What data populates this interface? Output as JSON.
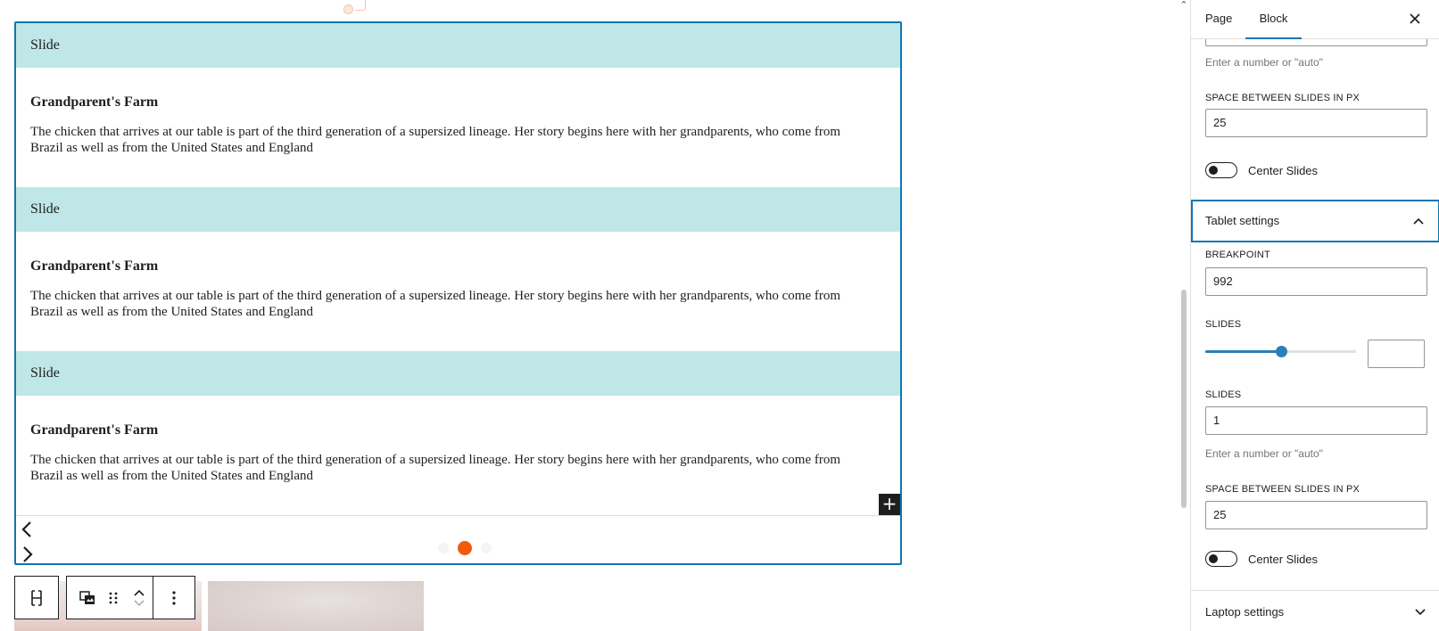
{
  "slider": {
    "slides": [
      {
        "label": "Slide",
        "heading": "Grandparent's Farm",
        "text": "The chicken that arrives at our table is part of the third generation of a supersized lineage. Her story begins here with her grandparents, who come from Brazil as well as from the United States and England"
      },
      {
        "label": "Slide",
        "heading": "Grandparent's Farm",
        "text": "The chicken that arrives at our table is part of the third generation of a supersized lineage. Her story begins here with her grandparents, who come from Brazil as well as from the United States and England"
      },
      {
        "label": "Slide",
        "heading": "Grandparent's Farm",
        "text": "The chicken that arrives at our table is part of the third generation of a supersized lineage. Her story begins here with her grandparents, who come from Brazil as well as from the United States and England"
      }
    ],
    "add_block_label": "+",
    "pagination": {
      "count": 3,
      "active": 2,
      "active_color": "#f35a0f"
    }
  },
  "toolbar": {
    "parent_icon": "select-parent-icon",
    "type_icon": "slider-block-icon",
    "drag_icon": "drag-handle-icon",
    "move_up_icon": "chevron-up-icon",
    "move_down_icon": "chevron-down-icon",
    "more_icon": "more-vertical-icon"
  },
  "sidebar": {
    "tabs": {
      "page": "Page",
      "block": "Block"
    },
    "desktop": {
      "slides_help": "Enter a number or \"auto\"",
      "space_label": "SPACE BETWEEN SLIDES IN PX",
      "space_value": "25",
      "center_label": "Center Slides",
      "center_on": false
    },
    "tablet": {
      "title": "Tablet settings",
      "breakpoint_label": "BREAKPOINT",
      "breakpoint_value": "992",
      "slides_range_label": "SLIDES",
      "slides_range_fraction": 0.5,
      "slides_range_number": "",
      "slides_label": "SLIDES",
      "slides_value": "1",
      "slides_help": "Enter a number or \"auto\"",
      "space_label": "SPACE BETWEEN SLIDES IN PX",
      "space_value": "25",
      "center_label": "Center Slides",
      "center_on": false
    },
    "laptop": {
      "title": "Laptop settings"
    }
  },
  "colors": {
    "accent": "#0f76b3",
    "slide_header_bg": "#bfe7e7",
    "range_fill": "#2a7fb8"
  }
}
